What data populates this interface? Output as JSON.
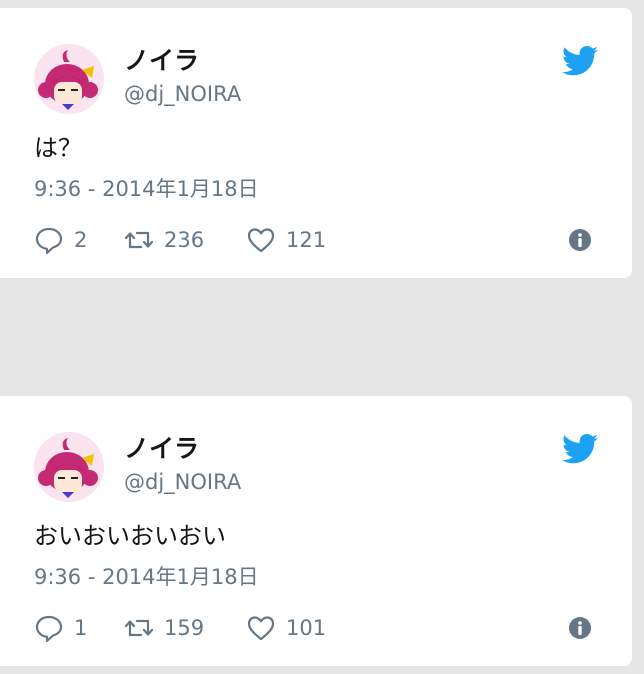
{
  "tweets": [
    {
      "display_name": "ノイラ",
      "handle": "@dj_NOIRA",
      "text": "は？",
      "timestamp": "9:36 - 2014年1月18日",
      "replies": "2",
      "retweets": "236",
      "likes": "121"
    },
    {
      "display_name": "ノイラ",
      "handle": "@dj_NOIRA",
      "text": "おいおいおいおい",
      "timestamp": "9:36 - 2014年1月18日",
      "replies": "1",
      "retweets": "159",
      "likes": "101"
    }
  ],
  "icons": {
    "brand": "twitter-bird-icon",
    "reply": "reply-icon",
    "retweet": "retweet-icon",
    "like": "heart-icon",
    "info": "info-icon"
  },
  "colors": {
    "brand": "#1da1f2",
    "muted": "#657786",
    "text": "#14171a",
    "background": "#e6e6e6",
    "card": "#ffffff"
  }
}
